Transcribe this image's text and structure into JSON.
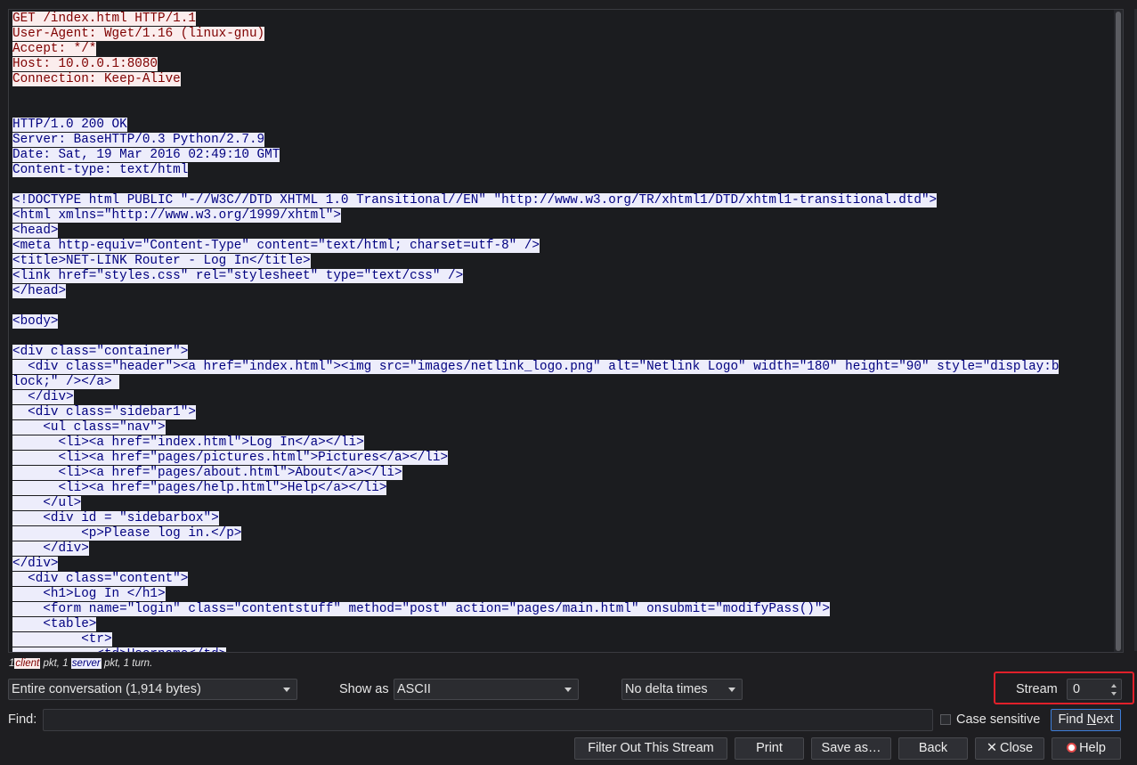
{
  "stream": {
    "lines": [
      {
        "dir": "client",
        "text": "GET /index.html HTTP/1.1"
      },
      {
        "dir": "client",
        "text": "User-Agent: Wget/1.16 (linux-gnu)"
      },
      {
        "dir": "client",
        "text": "Accept: */*"
      },
      {
        "dir": "client",
        "text": "Host: 10.0.0.1:8080"
      },
      {
        "dir": "client",
        "text": "Connection: Keep-Alive"
      },
      {
        "dir": "none",
        "text": ""
      },
      {
        "dir": "none",
        "text": ""
      },
      {
        "dir": "server",
        "text": "HTTP/1.0 200 OK"
      },
      {
        "dir": "server",
        "text": "Server: BaseHTTP/0.3 Python/2.7.9"
      },
      {
        "dir": "server",
        "text": "Date: Sat, 19 Mar 2016 02:49:10 GMT"
      },
      {
        "dir": "server",
        "text": "Content-type: text/html"
      },
      {
        "dir": "none",
        "text": ""
      },
      {
        "dir": "server",
        "text": "<!DOCTYPE html PUBLIC \"-//W3C//DTD XHTML 1.0 Transitional//EN\" \"http://www.w3.org/TR/xhtml1/DTD/xhtml1-transitional.dtd\">"
      },
      {
        "dir": "server",
        "text": "<html xmlns=\"http://www.w3.org/1999/xhtml\">"
      },
      {
        "dir": "server",
        "text": "<head>"
      },
      {
        "dir": "server",
        "text": "<meta http-equiv=\"Content-Type\" content=\"text/html; charset=utf-8\" />"
      },
      {
        "dir": "server",
        "text": "<title>NET-LINK Router - Log In</title>"
      },
      {
        "dir": "server",
        "text": "<link href=\"styles.css\" rel=\"stylesheet\" type=\"text/css\" />"
      },
      {
        "dir": "server",
        "text": "</head>"
      },
      {
        "dir": "none",
        "text": ""
      },
      {
        "dir": "server",
        "text": "<body>"
      },
      {
        "dir": "none",
        "text": ""
      },
      {
        "dir": "server",
        "text": "<div class=\"container\">"
      },
      {
        "dir": "server",
        "text": "  <div class=\"header\"><a href=\"index.html\"><img src=\"images/netlink_logo.png\" alt=\"Netlink Logo\" width=\"180\" height=\"90\" style=\"display:b"
      },
      {
        "dir": "server",
        "text": "lock;\" /></a> "
      },
      {
        "dir": "server",
        "text": "  </div>"
      },
      {
        "dir": "server",
        "text": "  <div class=\"sidebar1\">"
      },
      {
        "dir": "server",
        "text": "    <ul class=\"nav\">"
      },
      {
        "dir": "server",
        "text": "      <li><a href=\"index.html\">Log In</a></li>"
      },
      {
        "dir": "server",
        "text": "      <li><a href=\"pages/pictures.html\">Pictures</a></li>"
      },
      {
        "dir": "server",
        "text": "      <li><a href=\"pages/about.html\">About</a></li>"
      },
      {
        "dir": "server",
        "text": "      <li><a href=\"pages/help.html\">Help</a></li>"
      },
      {
        "dir": "server",
        "text": "    </ul>"
      },
      {
        "dir": "server",
        "text": "    <div id = \"sidebarbox\">"
      },
      {
        "dir": "server",
        "text": "         <p>Please log in.</p>"
      },
      {
        "dir": "server",
        "text": "    </div>"
      },
      {
        "dir": "server",
        "text": "</div>"
      },
      {
        "dir": "server",
        "text": "  <div class=\"content\">"
      },
      {
        "dir": "server",
        "text": "    <h1>Log In </h1>"
      },
      {
        "dir": "server",
        "text": "    <form name=\"login\" class=\"contentstuff\" method=\"post\" action=\"pages/main.html\" onsubmit=\"modifyPass()\">"
      },
      {
        "dir": "server",
        "text": "    <table>"
      },
      {
        "dir": "server",
        "text": "         <tr>"
      },
      {
        "dir": "server",
        "text": "           <td>Username</td>"
      }
    ]
  },
  "summary": {
    "count1": "1",
    "client": "client",
    "mid": " pkt, 1 ",
    "server": "server",
    "tail": " pkt, 1 turn."
  },
  "controls": {
    "conversation": "Entire conversation (1,914 bytes)",
    "show_as_label": "Show as",
    "show_as_value": "ASCII",
    "delta": "No delta times",
    "stream_label": "Stream",
    "stream_value": "0",
    "find_label": "Find:",
    "find_value": "",
    "case_sensitive": "Case sensitive",
    "find_next_pre": "Find ",
    "find_next_u": "N",
    "find_next_post": "ext"
  },
  "buttons": {
    "filter_out": "Filter Out This Stream",
    "print": "Print",
    "save_as": "Save as…",
    "back": "Back",
    "close_icon": "✕",
    "close": "Close",
    "help": "Help"
  },
  "colors": {
    "client_bg": "#fbeded",
    "client_fg": "#7f0000",
    "server_bg": "#ededfb",
    "server_fg": "#00007f",
    "highlight": "#e0202a"
  }
}
